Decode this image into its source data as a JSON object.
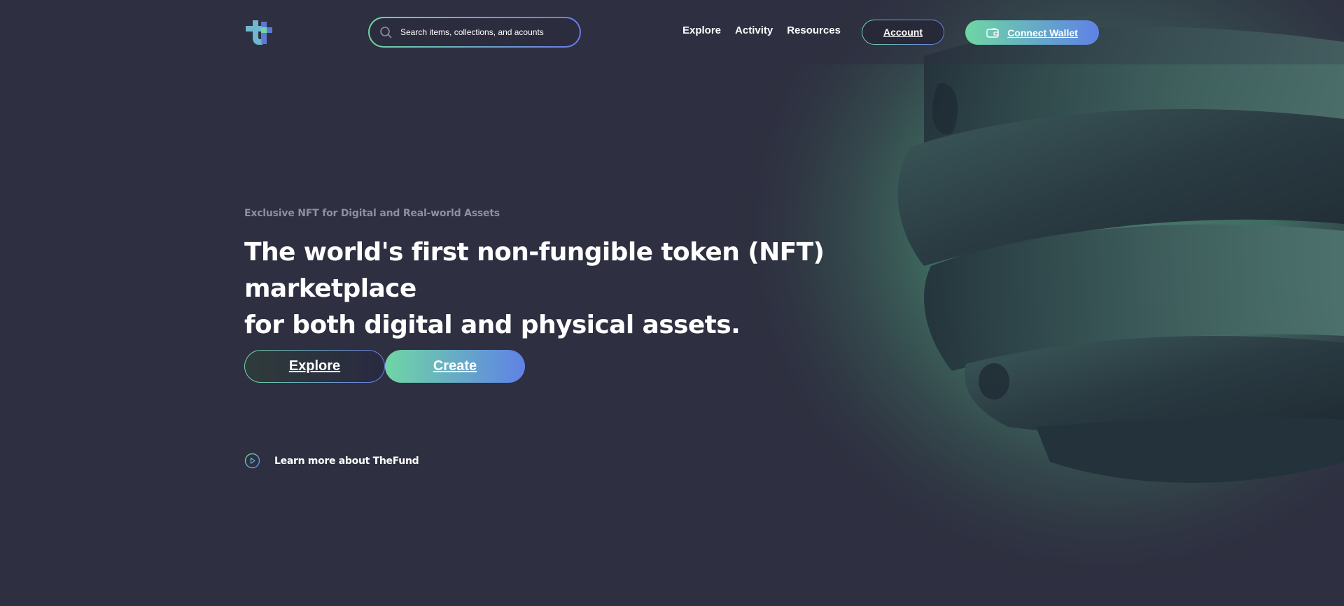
{
  "brand": {
    "logo_icon": "thefund-logo-icon"
  },
  "search": {
    "placeholder": "Search items, collections, and acounts",
    "icon": "search-icon"
  },
  "nav": {
    "items": [
      {
        "label": "Explore"
      },
      {
        "label": "Activity"
      },
      {
        "label": "Resources"
      }
    ]
  },
  "header_actions": {
    "account_label": "Account",
    "connect_wallet_label": "Connect Wallet",
    "wallet_icon": "wallet-icon"
  },
  "hero": {
    "eyebrow": "Exclusive NFT for Digital and Real-world Assets",
    "headline_line1": "The world's first non-fungible token (NFT) marketplace",
    "headline_line2": "for both digital and physical assets.",
    "explore_label": "Explore",
    "create_label": "Create",
    "learn_more_label": "Learn more about TheFund",
    "learn_more_icon": "play-circle-icon"
  },
  "colors": {
    "background": "#2e2f40",
    "accent_green": "#6fd6a4",
    "accent_blue": "#5f82e6",
    "muted_text": "#8f909e"
  }
}
